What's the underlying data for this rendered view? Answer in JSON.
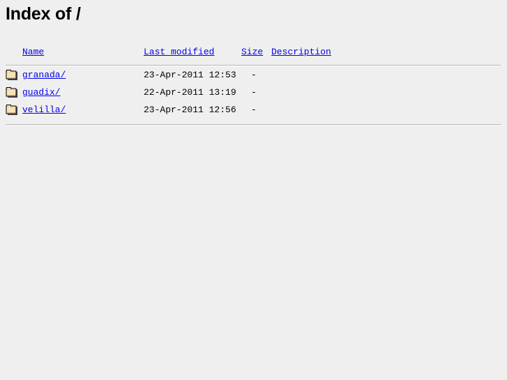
{
  "page": {
    "title_prefix": "Index of ",
    "title_path": "/",
    "background_color": "#efefef",
    "link_color": "#0000ee",
    "rule_color": "#b4b4b4",
    "folder_icon_color": "#f5deb3",
    "folder_icon_outline": "#000000"
  },
  "listing": {
    "columns": [
      {
        "key": "icon",
        "label": ""
      },
      {
        "key": "name",
        "label": "Name"
      },
      {
        "key": "date",
        "label": "Last modified"
      },
      {
        "key": "size",
        "label": "Size"
      },
      {
        "key": "desc",
        "label": "Description"
      }
    ],
    "headers": {
      "name": "Name",
      "last_modified": "Last modified",
      "size": "Size",
      "description": "Description"
    },
    "rows": [
      {
        "icon": "folder-icon",
        "name": "granada/",
        "last_modified": "23-Apr-2011 12:53",
        "size": "-",
        "description": ""
      },
      {
        "icon": "folder-icon",
        "name": "guadix/",
        "last_modified": "22-Apr-2011 13:19",
        "size": "-",
        "description": ""
      },
      {
        "icon": "folder-icon",
        "name": "velilla/",
        "last_modified": "23-Apr-2011 12:56",
        "size": "-",
        "description": ""
      }
    ]
  }
}
